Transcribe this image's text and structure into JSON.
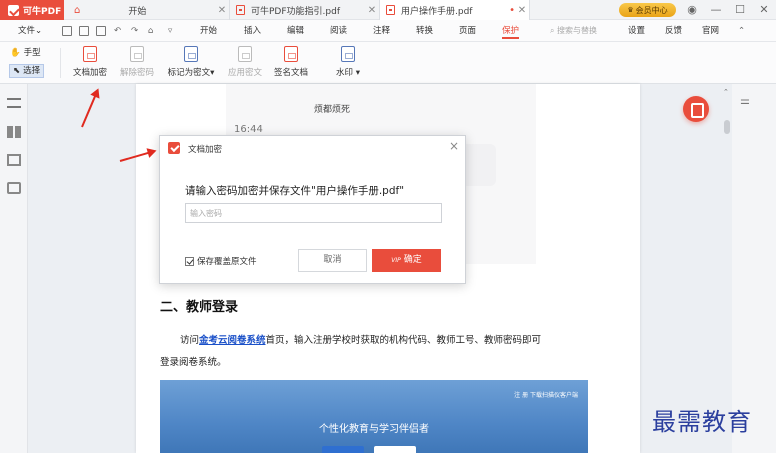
{
  "titlebar": {
    "app_name": "可牛PDF",
    "tabs": [
      {
        "label": "开始",
        "closable": true
      },
      {
        "label": "可牛PDF功能指引.pdf",
        "closable": true
      },
      {
        "label": "用户操作手册.pdf",
        "closable": true,
        "active": true,
        "modified_dot": "•"
      }
    ],
    "member_label": "会员中心",
    "window_buttons": {
      "minimize": "—",
      "maximize": "☐",
      "close": "✕"
    },
    "icons": [
      "home-icon",
      "pdf-file-icon"
    ]
  },
  "menubar": {
    "file_label": "文件",
    "file_caret": "⌄",
    "items": [
      "开始",
      "插入",
      "编辑",
      "阅读",
      "注释",
      "转换",
      "页面",
      "保护"
    ],
    "active_item": "保护",
    "search_label": "搜索与替换",
    "right_items": [
      "设置",
      "反馈",
      "官网"
    ],
    "collapse_icon": "⌃"
  },
  "ribbon": {
    "hand_label": "手型",
    "select_label": "选择",
    "tools": [
      {
        "label": "文档加密",
        "enabled": true
      },
      {
        "label": "解除密码",
        "enabled": false
      },
      {
        "label": "标记为密文▾",
        "enabled": true
      },
      {
        "label": "应用密文",
        "enabled": false
      },
      {
        "label": "签名文档",
        "enabled": true
      },
      {
        "label": "水印 ▾",
        "enabled": true
      }
    ]
  },
  "page": {
    "chat_name": "烦都烦死",
    "chat_time": "16:44",
    "heading": "二、教师登录",
    "para_prefix": "访问",
    "para_link": "金考云阅卷系统",
    "para_suffix": "首页，输入注册学校时获取的机构代码、教师工号、教师密码即可",
    "para_line2": "登录阅卷系统。",
    "web_nav": "注 册    下载扫描仪客户端",
    "web_title": "个性化教育与学习伴侣者"
  },
  "dialog": {
    "title": "文档加密",
    "close": "×",
    "prompt": "请输入密码加密并保存文件\"用户操作手册.pdf\"",
    "password_placeholder": "输入密码",
    "password_value": "",
    "overwrite_label": "保存覆盖原文件",
    "overwrite_checked": true,
    "cancel_label": "取消",
    "ok_vip_tag": "VIP",
    "ok_label": "确定"
  },
  "watermark": "最需教育",
  "colors": {
    "accent": "#e94d3c",
    "link": "#1a50c8",
    "annotation_arrow": "#e02a1f"
  }
}
